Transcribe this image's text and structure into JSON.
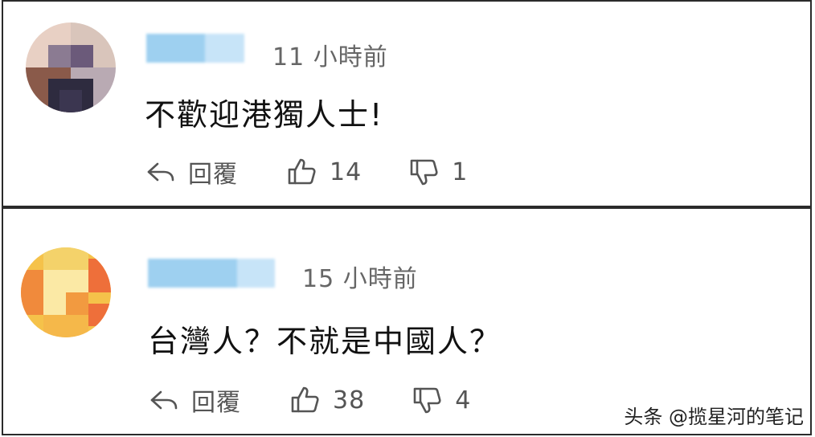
{
  "comments": [
    {
      "time": "11 小時前",
      "text": "不歡迎港獨人士!",
      "reply_label": "回覆",
      "likes": "14",
      "dislikes": "1",
      "avatar_icon": "pixelated-avatar-icon",
      "avatar_colors": [
        "#e8d0c4",
        "#8a5a4a",
        "#3b3650",
        "#b9aab3",
        "#6b5a7a",
        "#2e2b3f",
        "#d9c5bb",
        "#8b7b92"
      ],
      "name_colors": [
        "#9ed0f0",
        "#c7e4f8"
      ]
    },
    {
      "time": "15 小時前",
      "text": "台灣人？不就是中國人？",
      "reply_label": "回覆",
      "likes": "38",
      "dislikes": "4",
      "avatar_icon": "pixelated-avatar-icon",
      "avatar_colors": [
        "#f5c24a",
        "#f08a3c",
        "#f4d26a",
        "#ee6f3a",
        "#f7e08a",
        "#f29a40",
        "#f5b84a",
        "#fbe9a5"
      ],
      "name_colors": [
        "#9ed0f0",
        "#c7e4f8"
      ]
    }
  ],
  "icons": {
    "reply": "reply-arrow-icon",
    "like": "thumbs-up-icon",
    "dislike": "thumbs-down-icon"
  },
  "watermark": "头条 @揽星河的笔记"
}
